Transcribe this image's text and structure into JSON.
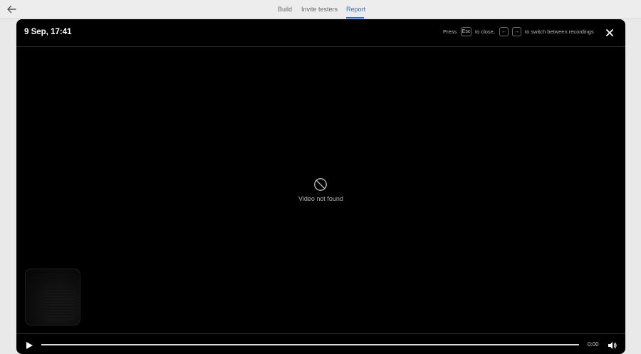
{
  "nav": {
    "tabs": [
      {
        "label": "Build",
        "active": false
      },
      {
        "label": "Invite testers",
        "active": false
      },
      {
        "label": "Report",
        "active": true
      }
    ]
  },
  "modal": {
    "title": "9 Sep, 17:41",
    "hint": {
      "press": "Press",
      "esc_key": "Esc",
      "to_close": "to close,",
      "left_key": "←",
      "right_key": "→",
      "to_switch": "to switch between recordings"
    },
    "placeholder_text": "Video not found",
    "time_display": "0:00"
  },
  "colors": {
    "accent": "#2a6fd6",
    "modal_bg": "#000000",
    "page_bg": "#e9e9e9"
  },
  "icons": [
    "back-arrow-icon",
    "close-icon",
    "video-unavailable-icon",
    "play-icon",
    "volume-icon"
  ]
}
